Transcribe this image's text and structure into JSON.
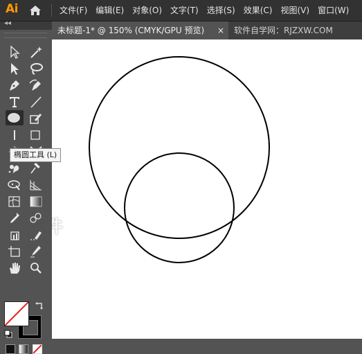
{
  "app": {
    "logo": "Ai"
  },
  "menu": {
    "items": [
      {
        "label": "文件(F)"
      },
      {
        "label": "编辑(E)"
      },
      {
        "label": "对象(O)"
      },
      {
        "label": "文字(T)"
      },
      {
        "label": "选择(S)"
      },
      {
        "label": "效果(C)"
      },
      {
        "label": "视图(V)"
      },
      {
        "label": "窗口(W)"
      }
    ]
  },
  "tabs": {
    "active": {
      "label": "未标题-1* @ 150% (CMYK/GPU 预览)",
      "close": "×"
    },
    "inactive": {
      "label": "软件自学网：RJZXW.COM"
    }
  },
  "toolbar": {
    "collapse": "◂◂",
    "tools": [
      {
        "icon": "selection-tool-icon"
      },
      {
        "icon": "magic-wand-tool-icon"
      },
      {
        "icon": "direct-selection-tool-icon"
      },
      {
        "icon": "lasso-tool-icon"
      },
      {
        "icon": "pen-tool-icon"
      },
      {
        "icon": "curvature-tool-icon"
      },
      {
        "icon": "type-tool-icon"
      },
      {
        "icon": "line-segment-tool-icon"
      },
      {
        "icon": "ellipse-tool-icon"
      },
      {
        "icon": "shaper-tool-icon"
      },
      {
        "icon": "width-tool-icon"
      },
      {
        "icon": "free-transform-tool-icon"
      },
      {
        "icon": "reflect-tool-icon"
      },
      {
        "icon": "shape-builder-tool-icon"
      },
      {
        "icon": "symbol-sprayer-tool-icon"
      },
      {
        "icon": "puppet-warp-tool-icon"
      },
      {
        "icon": "perspective-grid-tool-icon"
      },
      {
        "icon": "mesh-tool-icon"
      },
      {
        "icon": "gradient-tool-icon"
      },
      {
        "icon": "eyedropper-tool-icon"
      },
      {
        "icon": "blend-tool-icon"
      },
      {
        "icon": "artboard-tool-icon"
      },
      {
        "icon": "slice-tool-icon"
      },
      {
        "icon": "hand-tool-icon"
      },
      {
        "icon": "zoom-tool-icon"
      }
    ],
    "tooltip": "椭圆工具 (L)",
    "fill": "#ffffff",
    "stroke": "#000000"
  },
  "canvas": {
    "watermark": "软件",
    "shapes": [
      {
        "type": "ellipse",
        "name": "large-circle",
        "stroke": "#000000"
      },
      {
        "type": "ellipse",
        "name": "small-circle",
        "stroke": "#000000"
      }
    ]
  }
}
